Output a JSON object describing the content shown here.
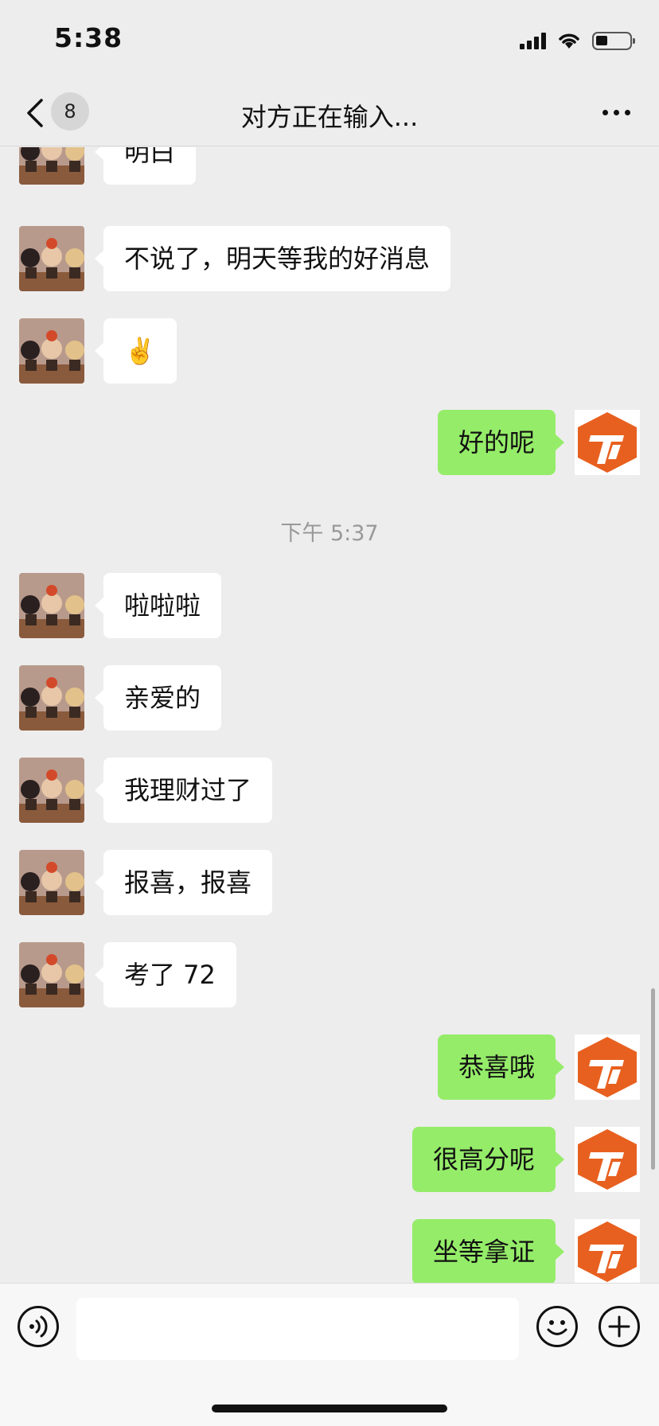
{
  "status_bar": {
    "time": "5:38",
    "battery_level": 0.35
  },
  "nav": {
    "unread_count": "8",
    "title": "对方正在输入..."
  },
  "messages": [
    {
      "side": "left",
      "text": "明白"
    },
    {
      "side": "left",
      "text": "不说了，明天等我的好消息"
    },
    {
      "side": "left",
      "text": "✌️"
    },
    {
      "side": "right",
      "text": "好的呢"
    },
    {
      "type": "time",
      "text": "下午 5:37"
    },
    {
      "side": "left",
      "text": "啦啦啦"
    },
    {
      "side": "left",
      "text": "亲爱的"
    },
    {
      "side": "left",
      "text": "我理财过了"
    },
    {
      "side": "left",
      "text": "报喜，报喜"
    },
    {
      "side": "left",
      "text": "考了 72"
    },
    {
      "side": "right",
      "text": "恭喜哦"
    },
    {
      "side": "right",
      "text": "很高分呢"
    },
    {
      "side": "right",
      "text": "坐等拿证"
    }
  ],
  "input": {
    "value": "",
    "placeholder": ""
  },
  "colors": {
    "background": "#ededed",
    "sent_bubble": "#95ec69",
    "received_bubble": "#ffffff",
    "avatar_brand": "#e8601f"
  },
  "icons": {
    "back": "chevron-left-icon",
    "more": "more-dots-icon",
    "voice": "voice-icon",
    "emoji": "smiley-icon",
    "plus": "plus-icon"
  }
}
